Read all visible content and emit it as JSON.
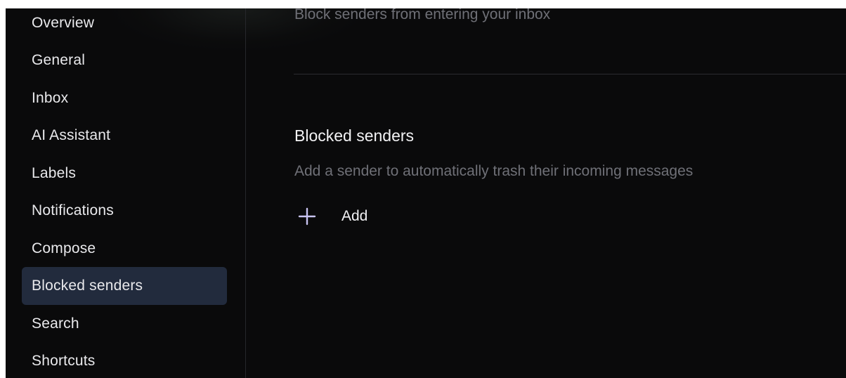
{
  "sidebar": {
    "items": [
      {
        "label": "Overview"
      },
      {
        "label": "General"
      },
      {
        "label": "Inbox"
      },
      {
        "label": "AI Assistant"
      },
      {
        "label": "Labels"
      },
      {
        "label": "Notifications"
      },
      {
        "label": "Compose"
      },
      {
        "label": "Blocked senders",
        "active": true
      },
      {
        "label": "Search"
      },
      {
        "label": "Shortcuts"
      }
    ]
  },
  "main": {
    "top_subtitle": "Block senders from entering your inbox",
    "section": {
      "title": "Blocked senders",
      "description": "Add a sender to automatically trash their incoming messages",
      "add_label": "Add",
      "add_icon": "plus-icon"
    }
  },
  "colors": {
    "background": "#0a0a0b",
    "active_item": "#222b3d",
    "muted_text": "#6f7077",
    "plus_icon": "#c9c4f2"
  }
}
